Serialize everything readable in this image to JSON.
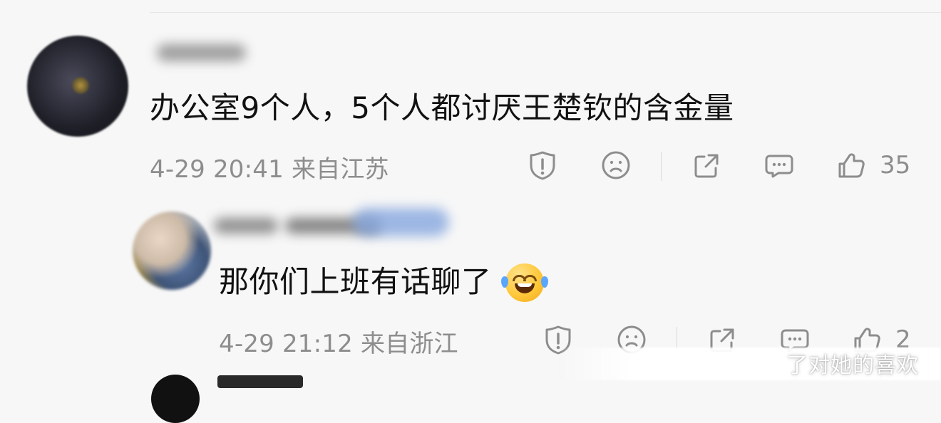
{
  "comments": [
    {
      "text": "办公室9个人，5个人都讨厌王楚钦的含金量",
      "meta": "4-29 20:41 来自江苏",
      "like_count": "35"
    },
    {
      "text": "那你们上班有话聊了",
      "meta": "4-29 21:12 来自浙江",
      "like_count": "2"
    }
  ],
  "watermark": "了对她的喜欢",
  "icons": {
    "report": "report-shield-icon",
    "dislike": "sad-face-icon",
    "share": "share-icon",
    "comment": "comment-bubble-icon",
    "like": "thumbs-up-icon"
  }
}
